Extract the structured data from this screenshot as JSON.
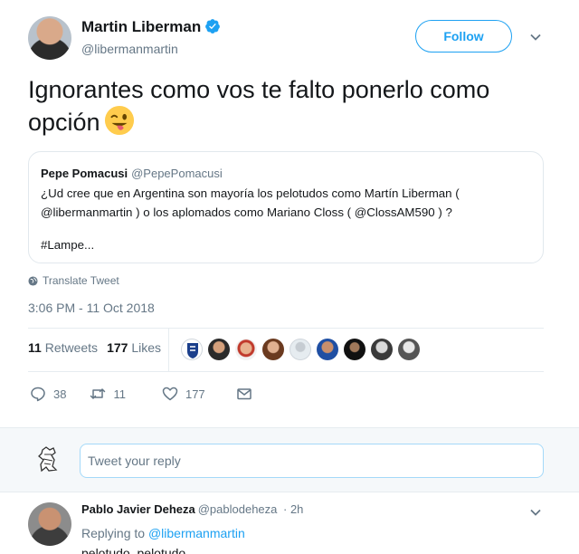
{
  "tweet": {
    "author_name": "Martin Liberman",
    "author_handle": "@libermanmartin",
    "follow_label": "Follow",
    "text": "Ignorantes como vos te falto ponerlo como opción",
    "emoji_icon": "winking-face-with-tongue",
    "quote": {
      "author_name": "Pepe Pomacusi",
      "author_handle": "@PepePomacusi",
      "line1": "¿Ud cree que en Argentina son mayoría los pelotudos como Martín Liberman (",
      "line2": "@libermanmartin ) o los aplomados como Mariano Closs ( @ClossAM590 ) ?",
      "line3": "#Lampe..."
    },
    "translate_label": "Translate Tweet",
    "timestamp": "3:06 PM - 11 Oct 2018",
    "stats": {
      "retweets_count": "11",
      "retweets_label": "Retweets",
      "likes_count": "177",
      "likes_label": "Likes"
    },
    "actions": {
      "replies": "38",
      "retweets": "11",
      "likes": "177"
    }
  },
  "reply_box": {
    "placeholder": "Tweet your reply"
  },
  "reply": {
    "author_name": "Pablo Javier Deheza",
    "author_handle": "@pablodeheza",
    "age": "· 2h",
    "replying_prefix": "Replying to",
    "replying_to": "@libermanmartin",
    "text": "pelotudo, pelotudo"
  },
  "colors": {
    "accent": "#1da1f2",
    "muted": "#657786",
    "text": "#14171a"
  }
}
